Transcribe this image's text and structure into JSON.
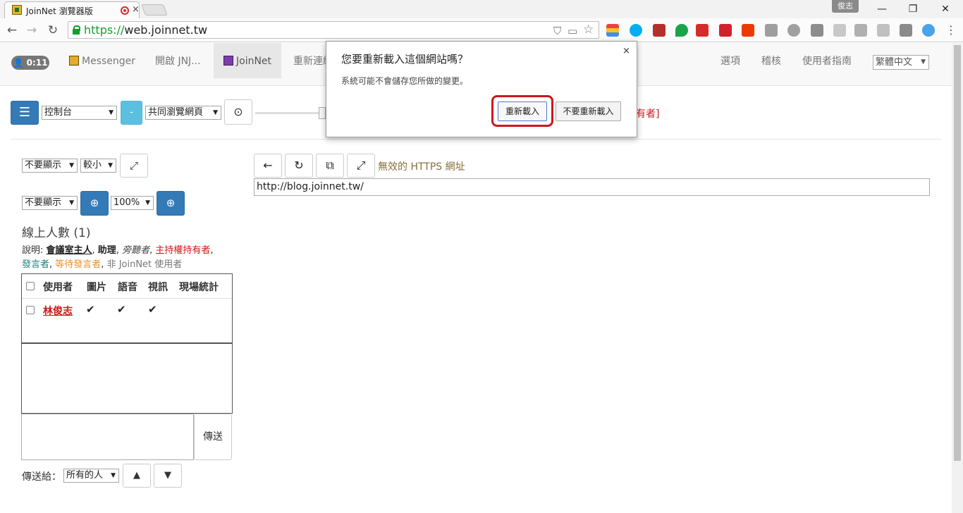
{
  "browser": {
    "tab_title": "JoinNet 瀏覽器版",
    "tab_close": "×",
    "profile_name": "俊志",
    "window_controls": {
      "minimize": "—",
      "restore": "❐",
      "close": "✕"
    },
    "url_scheme": "https://",
    "url_host": "web.joinnet.tw",
    "nav": {
      "back": "←",
      "forward": "→",
      "reload": "↻"
    }
  },
  "navbar": {
    "timer": "0:11",
    "items": [
      "Messenger",
      "開啟 JNJ...",
      "JoinNet",
      "重新連線"
    ],
    "right_items": [
      "選項",
      "稽核",
      "使用者指南"
    ],
    "language": "繁體中文"
  },
  "controls": {
    "menu_select": "控制台",
    "minus_label": "-",
    "mode_select": "共同瀏覽網頁",
    "obscured_text": "有者]"
  },
  "left_panel": {
    "display_select_1": "不要顯示",
    "size_select": "較小",
    "display_select_2": "不要顯示",
    "zoom_select": "100%",
    "online_count_title": "線上人數 (1)",
    "legend": {
      "prefix": "說明: ",
      "host": "會議室主人",
      "assistant": "助理",
      "observer": "旁聽者",
      "owner": "主持權持有者",
      "speaker": "發言者",
      "waiting": "等待發言者",
      "non_user": "非 JoinNet 使用者"
    },
    "table_headers": [
      "使用者",
      "圖片",
      "語音",
      "視訊",
      "現場統計"
    ],
    "rows": [
      {
        "user": "林俊志",
        "photo": "✔",
        "voice": "✔",
        "video": "✔"
      }
    ],
    "send_button": "傳送",
    "send_to_label": "傳送給：",
    "recipient_select": "所有的人"
  },
  "browser_panel": {
    "https_warning": "無效的 HTTPS 網址",
    "url_value": "http://blog.joinnet.tw/"
  },
  "dialog": {
    "title": "您要重新載入這個網站嗎？",
    "message": "系統可能不會儲存您所做的變更。",
    "close": "×",
    "reload_button": "重新載入",
    "dont_reload_button": "不要重新載入"
  },
  "colors": {
    "primary": "#337ab7",
    "info": "#5bc0de",
    "highlight": "#c8191f",
    "owner_red": "#d01515"
  }
}
